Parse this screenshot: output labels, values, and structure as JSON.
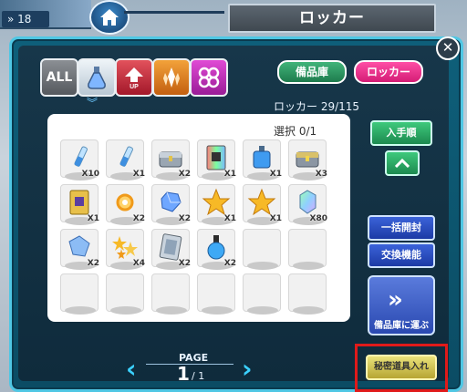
{
  "player": {
    "level": "18"
  },
  "header": {
    "title": "ロッカー"
  },
  "categories": {
    "all_label": "ALL",
    "up_label": "UP"
  },
  "tabs": {
    "storage": "備品庫",
    "locker": "ロッカー"
  },
  "capacity": "ロッカー 29/115",
  "selection": "選択 0/1",
  "icons": {
    "home": "home-icon",
    "close": "close-icon",
    "potion": "potion-icon",
    "up": "up-arrow-icon",
    "crystal": "crystal-icon",
    "gears": "gears-icon"
  },
  "items": [
    {
      "icon": "vial",
      "count": "X10"
    },
    {
      "icon": "vial",
      "count": "X1"
    },
    {
      "icon": "chest-silver",
      "count": "X2"
    },
    {
      "icon": "card-rainbow",
      "count": "X1"
    },
    {
      "icon": "blue-bottle",
      "count": "X1"
    },
    {
      "icon": "chest-gold",
      "count": "X3"
    },
    {
      "icon": "card-gold",
      "count": "X1"
    },
    {
      "icon": "orb-gold",
      "count": "X2"
    },
    {
      "icon": "blue-gem",
      "count": "X2"
    },
    {
      "icon": "star-gold",
      "count": "X1"
    },
    {
      "icon": "star-gold",
      "count": "X1"
    },
    {
      "icon": "rainbow-crystal",
      "count": "X80"
    },
    {
      "icon": "blue-shard",
      "count": "X2"
    },
    {
      "icon": "star-cluster",
      "count": "X4"
    },
    {
      "icon": "card-silver",
      "count": "X2"
    },
    {
      "icon": "round-flask",
      "count": "X2"
    },
    {
      "icon": "empty",
      "count": ""
    },
    {
      "icon": "empty",
      "count": ""
    },
    {
      "icon": "empty",
      "count": ""
    },
    {
      "icon": "empty",
      "count": ""
    },
    {
      "icon": "empty",
      "count": ""
    },
    {
      "icon": "empty",
      "count": ""
    },
    {
      "icon": "empty",
      "count": ""
    },
    {
      "icon": "empty",
      "count": ""
    }
  ],
  "side_buttons": {
    "sort": "入手順",
    "bulk_open": "一括開封",
    "exchange": "交換機能",
    "move_to_storage": "備品庫に運ぶ",
    "secret_tools": "秘密道具入れ"
  },
  "pager": {
    "label": "PAGE",
    "current": "1",
    "total": "/ 1"
  },
  "colors": {
    "frame": "#0e5f7a",
    "accent": "#4fc7e4",
    "highlight": "#e01a1a"
  }
}
